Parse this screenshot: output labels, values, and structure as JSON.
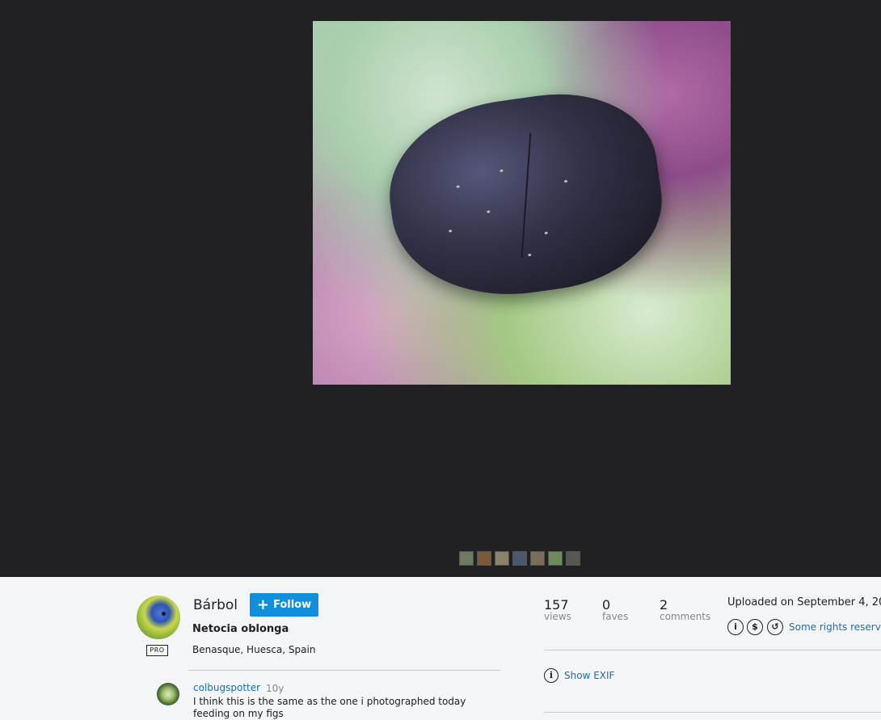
{
  "photo": {
    "subject": "beetle-on-thistle"
  },
  "thumbnails": {
    "colors": [
      "#6c7a62",
      "#7a5a3a",
      "#8b8268",
      "#4a5a6a",
      "#7a6e58",
      "#6d8a5a",
      "#55584c"
    ]
  },
  "owner": {
    "name": "Bárbol",
    "pro_badge": "PRO",
    "follow_label": "Follow",
    "photo_title": "Netocia oblonga",
    "location": "Benasque, Huesca, Spain"
  },
  "comment": {
    "user": "colbugspotter",
    "time": "10y",
    "text": "I think this is the same as the one i photographed today feeding on my figs"
  },
  "stats": {
    "views": {
      "value": "157",
      "label": "views"
    },
    "faves": {
      "value": "0",
      "label": "faves"
    },
    "comments": {
      "value": "2",
      "label": "comments"
    }
  },
  "meta": {
    "uploaded": "Uploaded on September 4, 20",
    "rights_label": "Some rights reserved",
    "show_exif": "Show EXIF"
  },
  "colors": {
    "viewer_bg": "#212124",
    "accent": "#128fdc",
    "link": "#1c6fb3"
  }
}
